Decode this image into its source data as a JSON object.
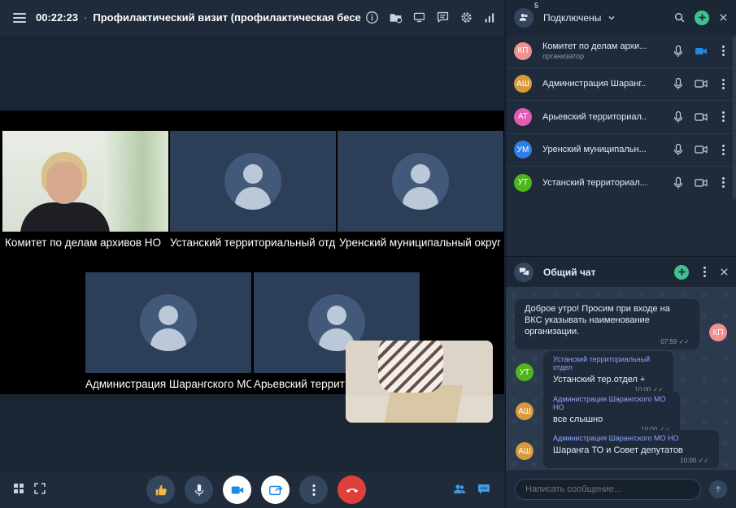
{
  "topbar": {
    "timer": "00:22:23",
    "separator": "·",
    "title": "Профилактический визит (профилактическая бесе..."
  },
  "tiles": [
    {
      "label": "Комитет по делам архивов НО",
      "kind": "video"
    },
    {
      "label": "Устанский территориальный отд",
      "kind": "avatar"
    },
    {
      "label": "Уренский муниципальный округ",
      "kind": "avatar"
    },
    {
      "label": "Администрация Шарангского МС",
      "kind": "avatar"
    },
    {
      "label": "Арьевский террит",
      "kind": "avatar"
    }
  ],
  "participants_panel": {
    "title": "Подключены",
    "count": "5",
    "items": [
      {
        "initials": "КП",
        "name": "Комитет по делам архи...",
        "role": "организатор",
        "color": "#f0908f",
        "camera_on": true
      },
      {
        "initials": "АШ",
        "name": "Администрация Шаранг...",
        "role": "",
        "color": "#d99a3a",
        "camera_on": false
      },
      {
        "initials": "АТ",
        "name": "Арьевский территориал...",
        "role": "",
        "color": "#e35bb4",
        "camera_on": false
      },
      {
        "initials": "УМ",
        "name": "Уренский муниципальн...",
        "role": "",
        "color": "#2f7fe6",
        "camera_on": false
      },
      {
        "initials": "УТ",
        "name": "Устанский территориал...",
        "role": "",
        "color": "#4fb51f",
        "camera_on": false
      }
    ]
  },
  "chat": {
    "title": "Общий чат",
    "messages": [
      {
        "author": "",
        "initials": "КП",
        "color": "#f0908f",
        "text": "Доброе утро! Просим при входе на ВКС указывать наименование организации.",
        "time": "07:59"
      },
      {
        "author": "Устанский территориальный отдел",
        "initials": "УТ",
        "color": "#4fb51f",
        "text": "Устанский тер.отдел +",
        "time": "10:00"
      },
      {
        "author": "Администрация Шарангского МО НО",
        "initials": "АШ",
        "color": "#d99a3a",
        "text": "все слышно",
        "time": "10:00"
      },
      {
        "author": "Администрация Шарангского МО НО",
        "initials": "АШ",
        "color": "#d99a3a",
        "text": "Шаранга ТО и Совет депутатов",
        "time": "10:00"
      }
    ],
    "input_placeholder": "Написать сообщение..."
  },
  "colors": {
    "accent_green": "#3fc28f",
    "hangup_red": "#e0403a",
    "active_blue": "#1e88e5"
  }
}
